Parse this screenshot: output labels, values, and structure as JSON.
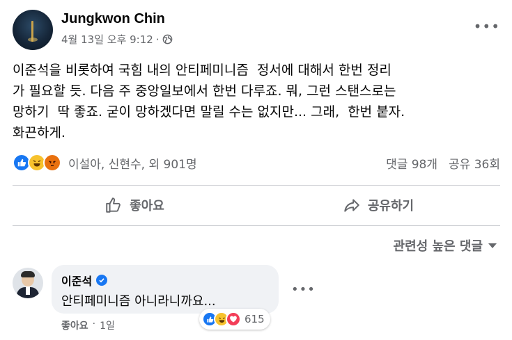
{
  "post": {
    "author": "Jungkwon Chin",
    "date": "4월 13일 오후 9:12",
    "separator": "·",
    "more_icon": "more-horizontal-icon",
    "privacy_icon": "globe-icon",
    "body": "이준석을 비롯하여 국힘 내의 안티페미니즘  정서에 대해서 한번 정리\n가 필요할 듯. 다음 주 중앙일보에서 한번 다루죠. 뭐, 그런 스탠스로는\n망하기  딱 좋죠. 굳이 망하겠다면 말릴 수는 없지만... 그래,  한번 붙자.\n화끈하게."
  },
  "reactions": {
    "icons": [
      "like-icon",
      "haha-icon",
      "angry-icon"
    ],
    "names": "이설아, 신현수, 외 901명",
    "comments": "댓글 98개",
    "shares": "공유 36회"
  },
  "actions": {
    "like_label": "좋아요",
    "share_label": "공유하기"
  },
  "comments": {
    "sort_label": "관련성 높은 댓글",
    "items": [
      {
        "author": "이준석",
        "text": "안티페미니즘 아니라니까요...",
        "like_label": "좋아요",
        "time": "1일",
        "reaction_count": "615",
        "reaction_icons": [
          "like-icon",
          "haha-icon",
          "love-icon"
        ]
      }
    ]
  },
  "colors": {
    "accent": "#1877f2",
    "secondary_text": "#65676b",
    "bubble_bg": "#f0f2f5"
  }
}
